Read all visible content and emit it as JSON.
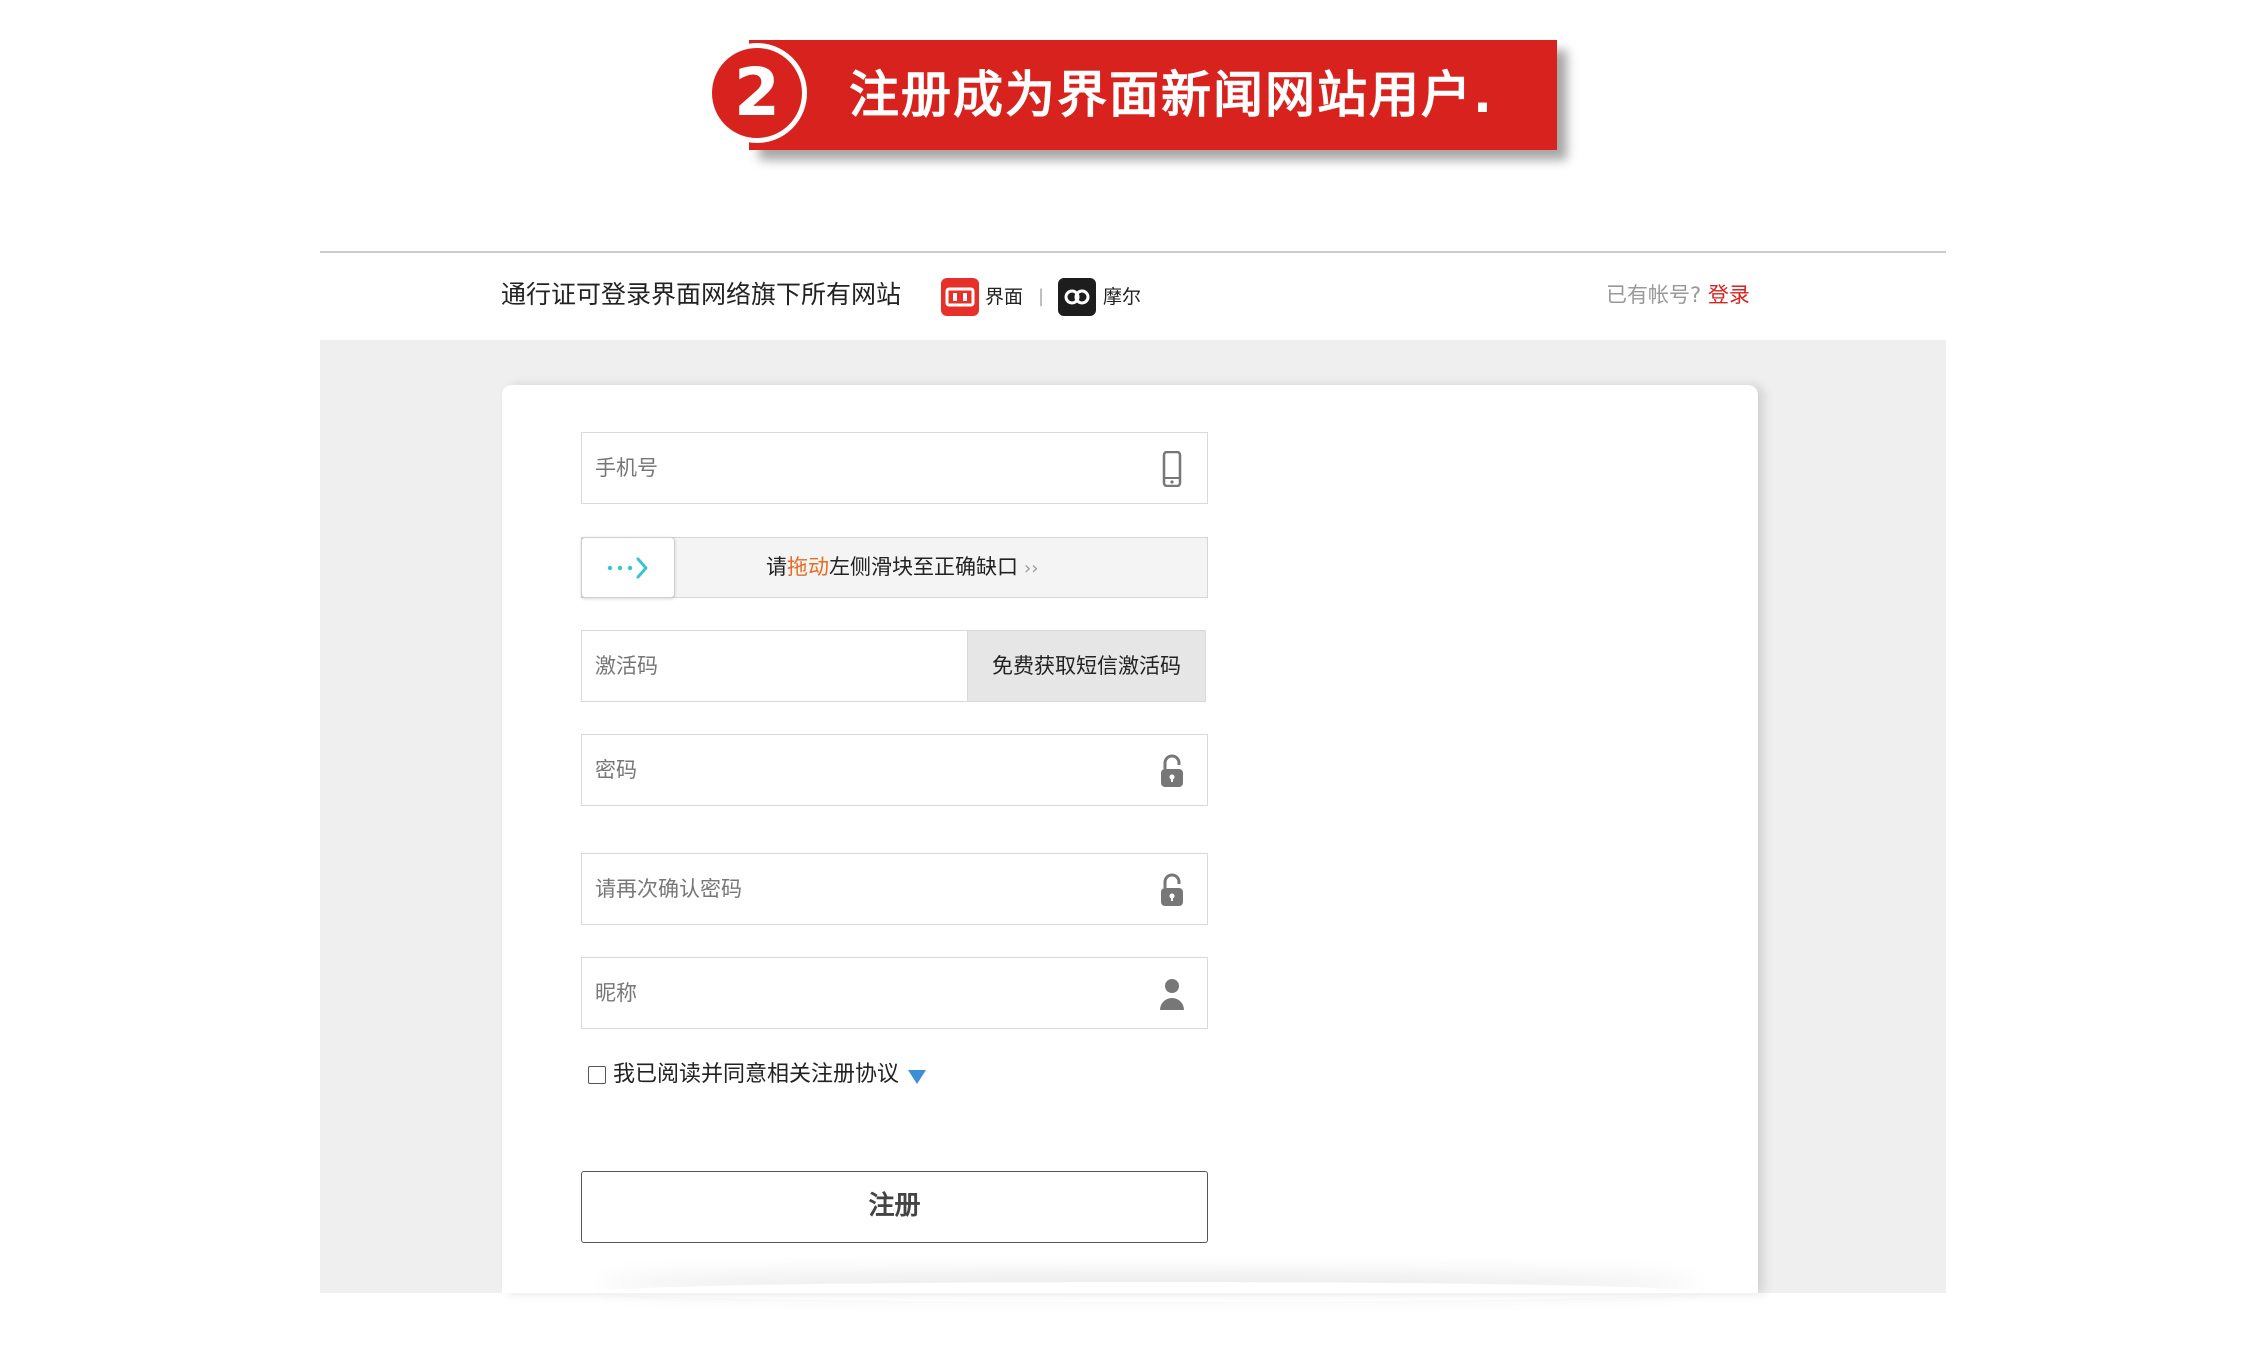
{
  "banner": {
    "step_number": "2",
    "title": "注册成为界面新闻网站用户."
  },
  "header": {
    "passport_text": "通行证可登录界面网络旗下所有网站",
    "brands": [
      {
        "label": "界面",
        "icon": "jiemian-logo-icon"
      },
      {
        "label": "摩尔",
        "icon": "moer-logo-icon"
      }
    ],
    "separator": "|",
    "have_account": "已有帐号?",
    "login_link": "登录"
  },
  "form": {
    "phone_placeholder": "手机号",
    "slider": {
      "prefix": "请",
      "highlight": "拖动",
      "suffix": "左侧滑块至正确缺口",
      "chevrons": "››"
    },
    "code_placeholder": "激活码",
    "code_button": "免费获取短信激活码",
    "password_placeholder": "密码",
    "confirm_password_placeholder": "请再次确认密码",
    "nickname_placeholder": "昵称",
    "agreement_text": "我已阅读并同意相关注册协议",
    "agreement_checked": false,
    "submit_label": "注册"
  },
  "colors": {
    "brand_red": "#d8221e",
    "highlight_orange": "#e86c1f",
    "arrow_blue": "#3c8fd6",
    "slider_teal": "#37c6d0"
  }
}
